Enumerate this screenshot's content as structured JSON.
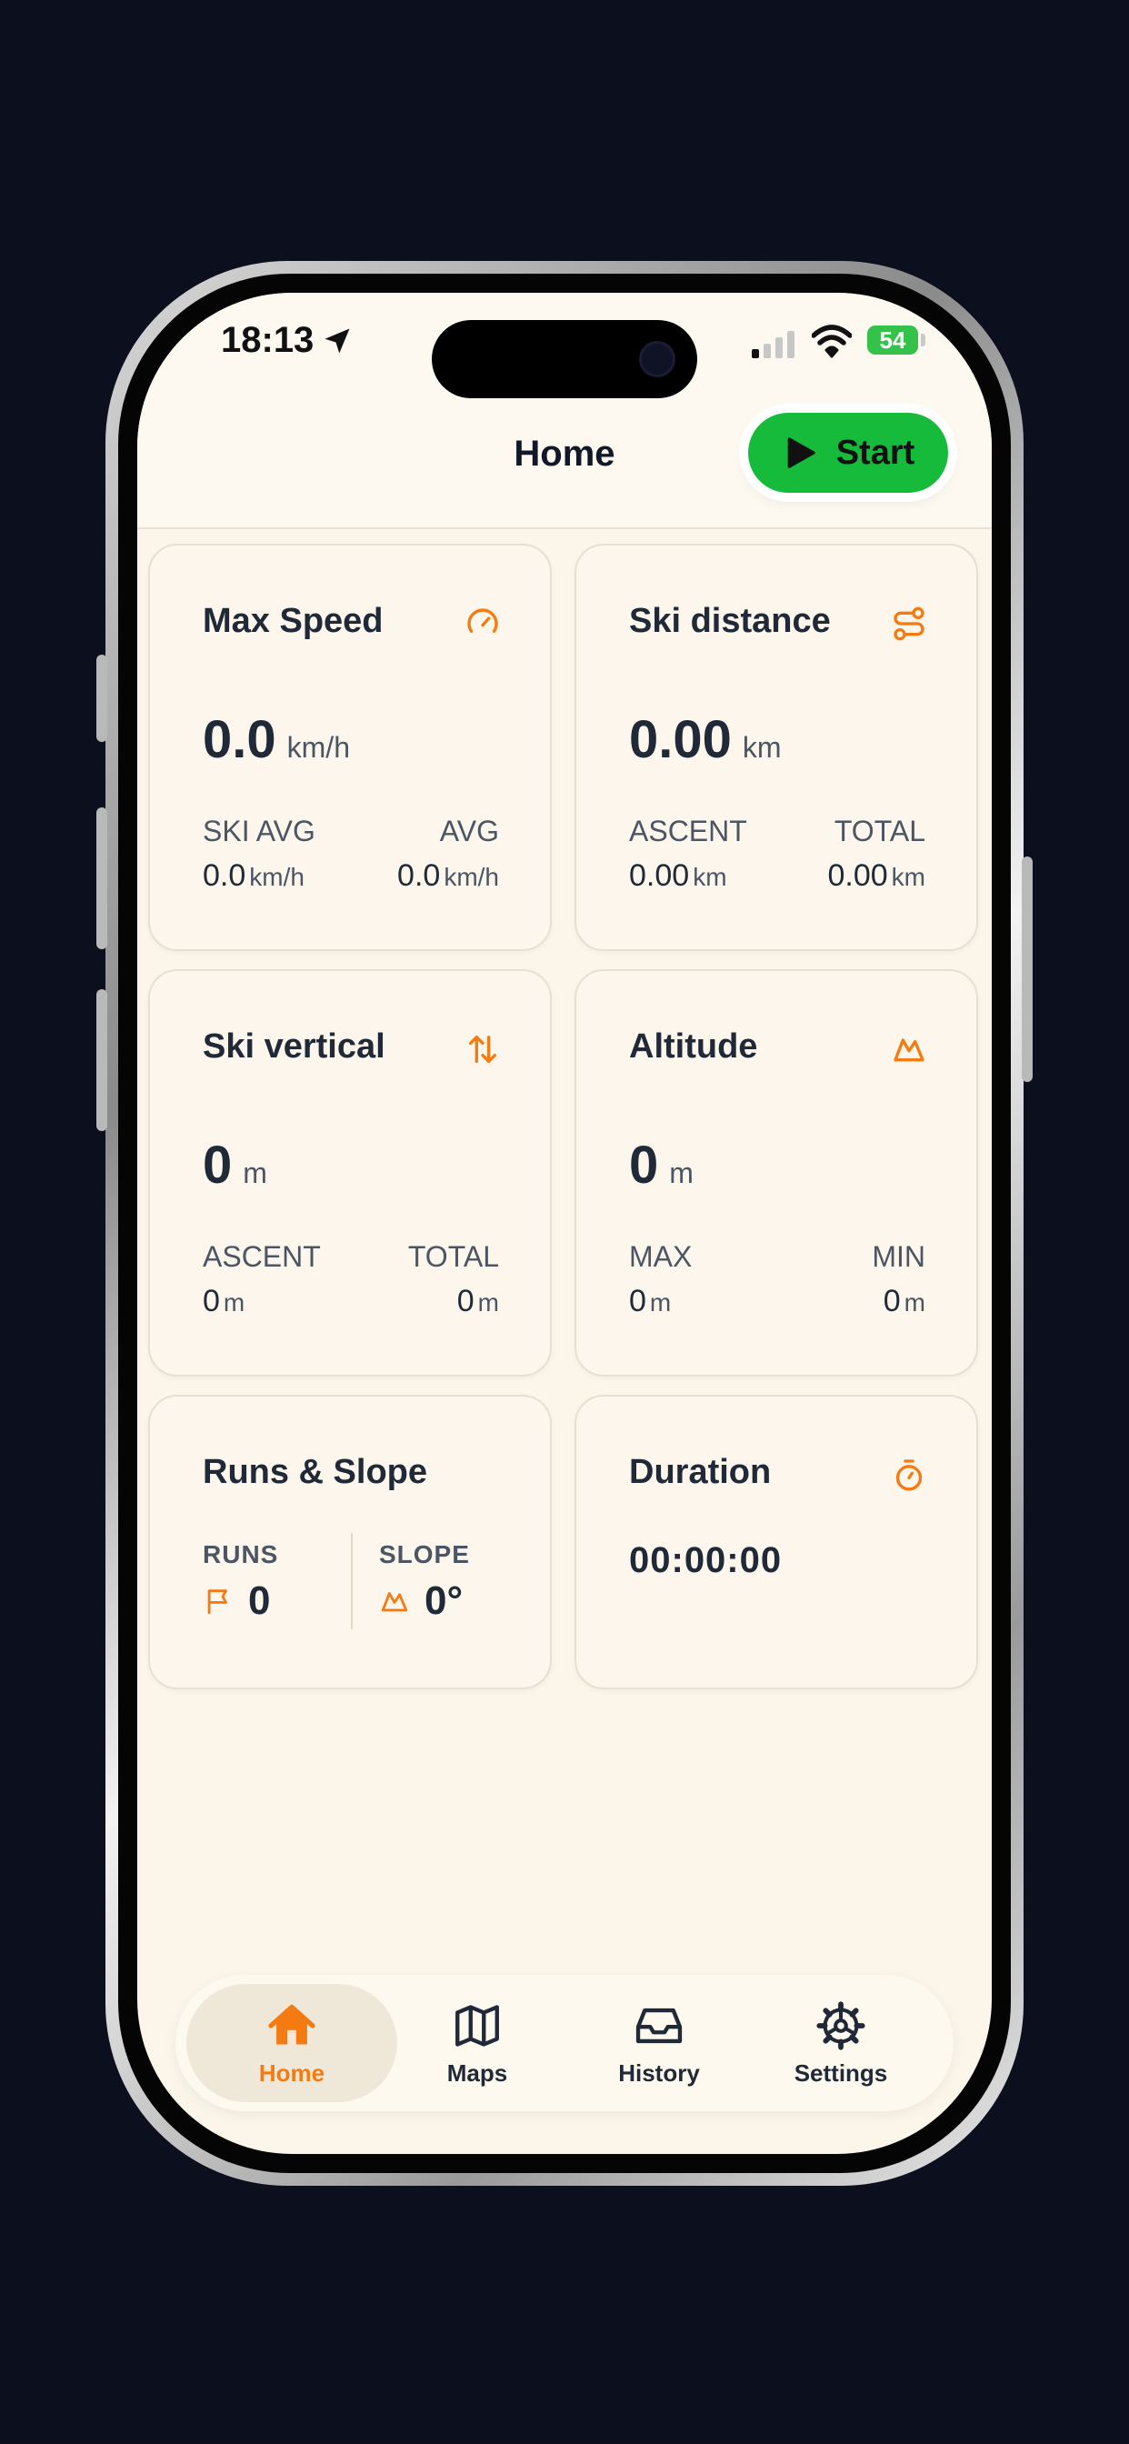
{
  "status_bar": {
    "time": "18:13",
    "battery": "54"
  },
  "header": {
    "title": "Home",
    "start_label": "Start"
  },
  "colors": {
    "accent": "#f47a12",
    "start_green": "#16bb3c",
    "battery_green": "#35c24a",
    "background": "#fbf5ea"
  },
  "cards": {
    "max_speed": {
      "title": "Max Speed",
      "icon": "speedometer-icon",
      "value": "0.0",
      "unit": "km/h",
      "left_label": "SKI AVG",
      "left_value": "0.0",
      "left_unit": "km/h",
      "right_label": "AVG",
      "right_value": "0.0",
      "right_unit": "km/h"
    },
    "ski_distance": {
      "title": "Ski distance",
      "icon": "route-icon",
      "value": "0.00",
      "unit": "km",
      "left_label": "ASCENT",
      "left_value": "0.00",
      "left_unit": "km",
      "right_label": "TOTAL",
      "right_value": "0.00",
      "right_unit": "km"
    },
    "ski_vertical": {
      "title": "Ski vertical",
      "icon": "up-down-arrows-icon",
      "value": "0",
      "unit": "m",
      "left_label": "ASCENT",
      "left_value": "0",
      "left_unit": "m",
      "right_label": "TOTAL",
      "right_value": "0",
      "right_unit": "m"
    },
    "altitude": {
      "title": "Altitude",
      "icon": "mountain-icon",
      "value": "0",
      "unit": "m",
      "left_label": "MAX",
      "left_value": "0",
      "left_unit": "m",
      "right_label": "MIN",
      "right_value": "0",
      "right_unit": "m"
    },
    "runs_slope": {
      "title": "Runs & Slope",
      "runs_label": "RUNS",
      "runs_value": "0",
      "slope_label": "SLOPE",
      "slope_value": "0°"
    },
    "duration": {
      "title": "Duration",
      "icon": "stopwatch-icon",
      "value": "00:00:00"
    }
  },
  "tabs": [
    {
      "label": "Home",
      "icon": "home-icon",
      "active": true
    },
    {
      "label": "Maps",
      "icon": "map-icon",
      "active": false
    },
    {
      "label": "History",
      "icon": "inbox-icon",
      "active": false
    },
    {
      "label": "Settings",
      "icon": "gear-icon",
      "active": false
    }
  ]
}
